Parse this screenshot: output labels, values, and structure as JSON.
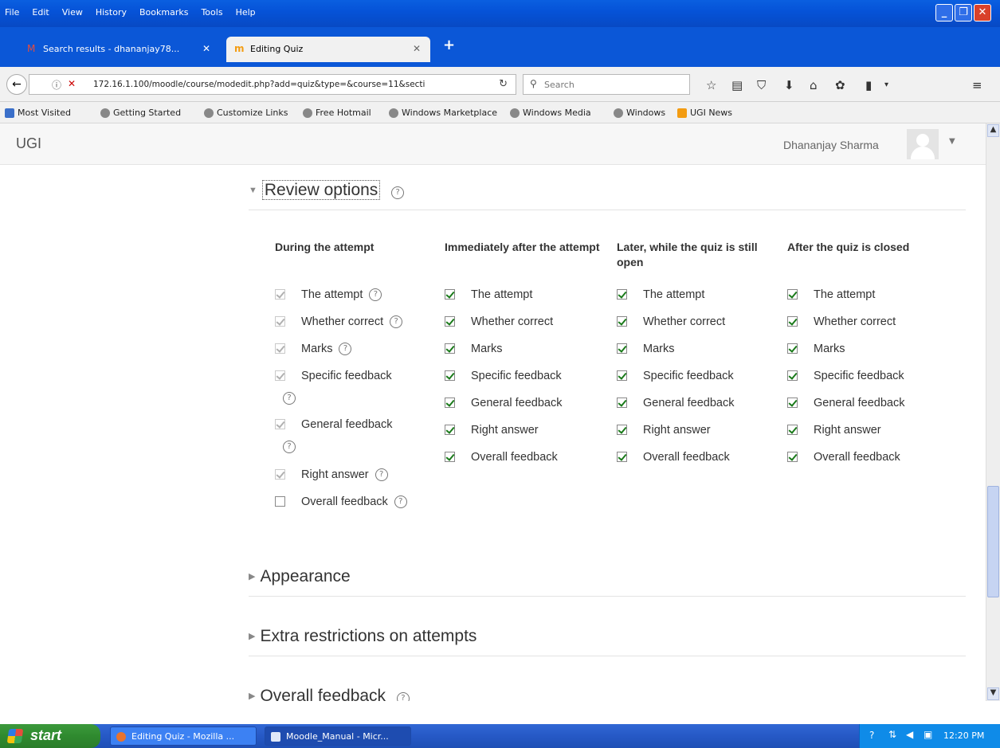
{
  "menu": [
    "File",
    "Edit",
    "View",
    "History",
    "Bookmarks",
    "Tools",
    "Help"
  ],
  "tabs": [
    {
      "title": "Search results - dhananjay78...",
      "icon": "gmail-icon"
    },
    {
      "title": "Editing Quiz",
      "icon": "moodle-icon"
    }
  ],
  "nav": {
    "url": "172.16.1.100/moodle/course/modedit.php?add=quiz&type=&course=11&secti",
    "search_placeholder": "Search"
  },
  "bookmarks": [
    "Most Visited",
    "Getting Started",
    "Customize Links",
    "Free Hotmail",
    "Windows Marketplace",
    "Windows Media",
    "Windows",
    "UGI News"
  ],
  "header": {
    "brand": "UGI",
    "user_name": "Dhananjay Sharma"
  },
  "review": {
    "title": "Review options",
    "columns": [
      {
        "heading": "During the attempt",
        "options": [
          {
            "label": "The attempt",
            "checked": true,
            "disabled": true,
            "help": true
          },
          {
            "label": "Whether correct",
            "checked": true,
            "disabled": true,
            "help": true
          },
          {
            "label": "Marks",
            "checked": true,
            "disabled": true,
            "help": true
          },
          {
            "label": "Specific feedback",
            "checked": true,
            "disabled": true,
            "help": true
          },
          {
            "label": "General feedback",
            "checked": true,
            "disabled": true,
            "help": true
          },
          {
            "label": "Right answer",
            "checked": true,
            "disabled": true,
            "help": true
          },
          {
            "label": "Overall feedback",
            "checked": false,
            "disabled": false,
            "help": true
          }
        ]
      },
      {
        "heading": "Immediately after the attempt",
        "options": [
          {
            "label": "The attempt",
            "checked": true
          },
          {
            "label": "Whether correct",
            "checked": true
          },
          {
            "label": "Marks",
            "checked": true
          },
          {
            "label": "Specific feedback",
            "checked": true
          },
          {
            "label": "General feedback",
            "checked": true
          },
          {
            "label": "Right answer",
            "checked": true
          },
          {
            "label": "Overall feedback",
            "checked": true
          }
        ]
      },
      {
        "heading": "Later, while the quiz is still open",
        "options": [
          {
            "label": "The attempt",
            "checked": true
          },
          {
            "label": "Whether correct",
            "checked": true
          },
          {
            "label": "Marks",
            "checked": true
          },
          {
            "label": "Specific feedback",
            "checked": true
          },
          {
            "label": "General feedback",
            "checked": true
          },
          {
            "label": "Right answer",
            "checked": true
          },
          {
            "label": "Overall feedback",
            "checked": true
          }
        ]
      },
      {
        "heading": "After the quiz is closed",
        "options": [
          {
            "label": "The attempt",
            "checked": true
          },
          {
            "label": "Whether correct",
            "checked": true
          },
          {
            "label": "Marks",
            "checked": true
          },
          {
            "label": "Specific feedback",
            "checked": true
          },
          {
            "label": "General feedback",
            "checked": true
          },
          {
            "label": "Right answer",
            "checked": true
          },
          {
            "label": "Overall feedback",
            "checked": true
          }
        ]
      }
    ]
  },
  "sections": {
    "appearance": "Appearance",
    "extra_restrictions": "Extra restrictions on attempts",
    "overall_feedback": "Overall feedback"
  },
  "taskbar": {
    "start": "start",
    "items": [
      "Editing Quiz - Mozilla ...",
      "Moodle_Manual - Micr..."
    ],
    "clock": "12:20 PM"
  }
}
